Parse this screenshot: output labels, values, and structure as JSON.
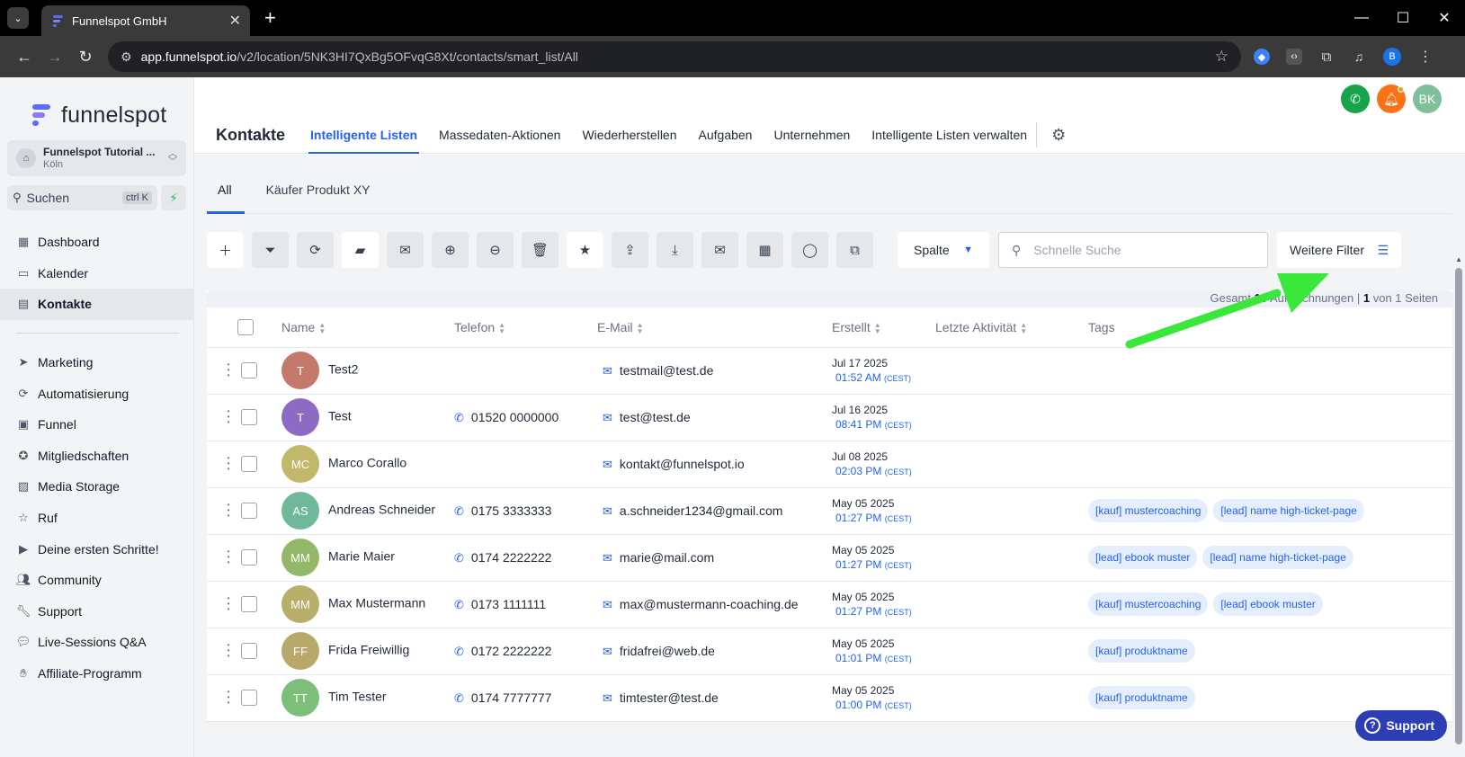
{
  "browser": {
    "tab_title": "Funnelspot GmbH",
    "url_domain": "app.funnelspot.io",
    "url_path": "/v2/location/5NK3HI7QxBg5OFvqG8Xt/contacts/smart_list/All",
    "profile_initial": "B"
  },
  "sidebar": {
    "logo_text": "funnelspot",
    "location_name": "Funnelspot Tutorial ...",
    "location_sub": "Köln",
    "search_label": "Suchen",
    "search_shortcut": "ctrl K",
    "items_top": [
      {
        "label": "Dashboard",
        "icon": "dashboard-icon"
      },
      {
        "label": "Kalender",
        "icon": "calendar-icon"
      },
      {
        "label": "Kontakte",
        "icon": "contacts-icon",
        "active": true
      }
    ],
    "items_bottom": [
      {
        "label": "Marketing",
        "icon": "send-icon"
      },
      {
        "label": "Automatisierung",
        "icon": "automation-icon"
      },
      {
        "label": "Funnel",
        "icon": "funnel-icon"
      },
      {
        "label": "Mitgliedschaften",
        "icon": "badge-icon"
      },
      {
        "label": "Media Storage",
        "icon": "image-icon"
      },
      {
        "label": "Ruf",
        "icon": "star-icon"
      },
      {
        "label": "Deine ersten Schritte!",
        "icon": "play-icon"
      },
      {
        "label": "Community",
        "icon": "people-icon"
      },
      {
        "label": "Support",
        "icon": "wrench-icon"
      },
      {
        "label": "Live-Sessions Q&A",
        "icon": "chat-icon"
      },
      {
        "label": "Affiliate-Programm",
        "icon": "hand-money-icon"
      }
    ]
  },
  "header": {
    "user_initials": "BK",
    "page_title": "Kontakte",
    "tabs": [
      {
        "label": "Intelligente Listen",
        "active": true
      },
      {
        "label": "Massedaten-Aktionen"
      },
      {
        "label": "Wiederherstellen"
      },
      {
        "label": "Aufgaben"
      },
      {
        "label": "Unternehmen"
      },
      {
        "label": "Intelligente Listen verwalten"
      }
    ]
  },
  "lists": {
    "tabs": [
      {
        "label": "All",
        "active": true
      },
      {
        "label": "Käufer Produkt XY"
      }
    ]
  },
  "toolbar": {
    "column_select": "Spalte",
    "quick_search_placeholder": "Schnelle Suche",
    "more_filters": "Weitere Filter"
  },
  "summary": {
    "prefix": "Gesamt",
    "count": "10",
    "suffix": "Aufzeichnungen |",
    "page": "1",
    "of_text": "von 1 Seiten"
  },
  "table": {
    "columns": [
      "Name",
      "Telefon",
      "E-Mail",
      "Erstellt",
      "Letzte Aktivität",
      "Tags"
    ],
    "rows": [
      {
        "initials": "T",
        "color": "#c47a6a",
        "name": "Test2",
        "phone": "",
        "email": "testmail@test.de",
        "date": "Jul 17 2025",
        "time": "01:52 AM",
        "tz": "(CEST)",
        "tags": []
      },
      {
        "initials": "T",
        "color": "#8e6bc2",
        "name": "Test",
        "phone": "01520 0000000",
        "email": "test@test.de",
        "date": "Jul 16 2025",
        "time": "08:41 PM",
        "tz": "(CEST)",
        "tags": []
      },
      {
        "initials": "MC",
        "color": "#c2b86a",
        "name": "Marco Corallo",
        "phone": "",
        "email": "kontakt@funnelspot.io",
        "date": "Jul 08 2025",
        "time": "02:03 PM",
        "tz": "(CEST)",
        "tags": []
      },
      {
        "initials": "AS",
        "color": "#6fb89a",
        "name": "Andreas Schneider",
        "phone": "0175 3333333",
        "email": "a.schneider1234@gmail.com",
        "date": "May 05 2025",
        "time": "01:27 PM",
        "tz": "(CEST)",
        "tags": [
          "[kauf] mustercoaching",
          "[lead] name high-ticket-page"
        ]
      },
      {
        "initials": "MM",
        "color": "#94b86a",
        "name": "Marie Maier",
        "phone": "0174 2222222",
        "email": "marie@mail.com",
        "date": "May 05 2025",
        "time": "01:27 PM",
        "tz": "(CEST)",
        "tags": [
          "[lead] ebook muster",
          "[lead] name high-ticket-page"
        ]
      },
      {
        "initials": "MM",
        "color": "#b8b06a",
        "name": "Max Mustermann",
        "phone": "0173 1111111",
        "email": "max@mustermann-coaching.de",
        "date": "May 05 2025",
        "time": "01:27 PM",
        "tz": "(CEST)",
        "tags": [
          "[kauf] mustercoaching",
          "[lead] ebook muster"
        ]
      },
      {
        "initials": "FF",
        "color": "#b8a86a",
        "name": "Frida Freiwillig",
        "phone": "0172 2222222",
        "email": "fridafrei@web.de",
        "date": "May 05 2025",
        "time": "01:01 PM",
        "tz": "(CEST)",
        "tags": [
          "[kauf] produktname"
        ]
      },
      {
        "initials": "TT",
        "color": "#7cbf7a",
        "name": "Tim Tester",
        "phone": "0174 7777777",
        "email": "timtester@test.de",
        "date": "May 05 2025",
        "time": "01:00 PM",
        "tz": "(CEST)",
        "tags": [
          "[kauf] produktname"
        ]
      }
    ]
  },
  "support_button": "Support",
  "colors": {
    "accent": "#2563eb",
    "arrow": "#39e83a",
    "phone_btn": "#16a34a",
    "bell_btn": "#f97316",
    "user_avatar": "#7fbf9a"
  }
}
